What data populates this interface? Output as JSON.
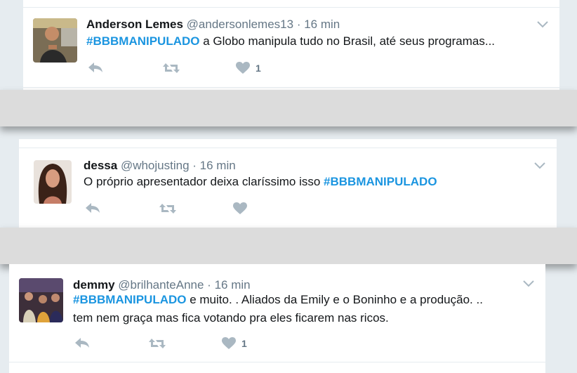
{
  "tweets": [
    {
      "name": "Anderson Lemes",
      "handle": "@andersonlemes13",
      "sep": "·",
      "time": "16 min",
      "hashtag": "#BBBMANIPULADO",
      "text": " a Globo manipula tudo no Brasil, até seus programas...",
      "likes": "1"
    },
    {
      "name": "dessa",
      "handle": "@whojusting",
      "sep": "·",
      "time": "16 min",
      "text": "O próprio apresentador deixa claríssimo isso ",
      "hashtag": "#BBBMANIPULADO",
      "likes": ""
    },
    {
      "name": "demmy",
      "handle": "@brilhanteAnne",
      "sep": "·",
      "time": "16 min",
      "hashtag": "#BBBMANIPULADO",
      "text": " e muito. . Aliados da Emily e o Boninho e a produção. ..",
      "text2": "tem nem graça mas fica votando pra eles ficarem nas ricos.",
      "likes": "1"
    }
  ],
  "colors": {
    "hashtag": "#1b95e0",
    "icon": "#aab8c2",
    "muted": "#657786"
  },
  "icons": [
    "reply-icon",
    "retweet-icon",
    "like-icon",
    "chevron-down-icon"
  ]
}
